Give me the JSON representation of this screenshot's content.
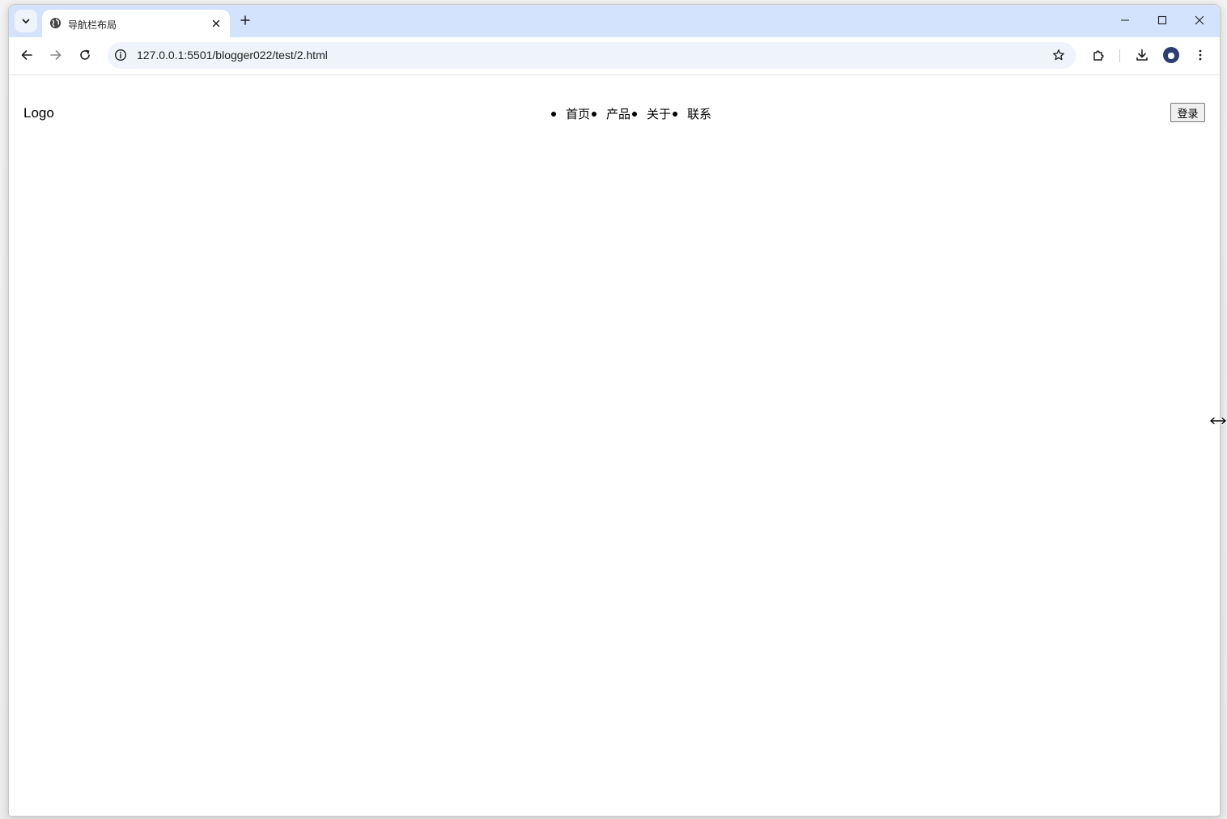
{
  "browser": {
    "tab": {
      "title": "导航栏布局"
    },
    "address_bar": {
      "url": "127.0.0.1:5501/blogger022/test/2.html"
    },
    "icons": {
      "tab_search": "chevron-down-icon",
      "favicon": "globe-icon",
      "tab_close": "close-icon",
      "new_tab": "plus-icon",
      "minimize": "minimize-icon",
      "maximize": "maximize-icon",
      "window_close": "close-icon",
      "back": "arrow-left-icon",
      "forward": "arrow-right-icon",
      "reload": "reload-icon",
      "site_info": "info-icon",
      "bookmark": "star-icon",
      "extensions": "puzzle-icon",
      "downloads": "download-icon",
      "profile": "avatar",
      "menu": "kebab-menu-icon"
    },
    "colors": {
      "tabstrip": "#d3e3fd",
      "omnibox": "#eef3fc"
    }
  },
  "page": {
    "logo": "Logo",
    "nav_items": [
      {
        "label": "首页"
      },
      {
        "label": "产品"
      },
      {
        "label": "关于"
      },
      {
        "label": "联系"
      }
    ],
    "login_button": "登录"
  },
  "cursor": "horizontal-resize-cursor"
}
